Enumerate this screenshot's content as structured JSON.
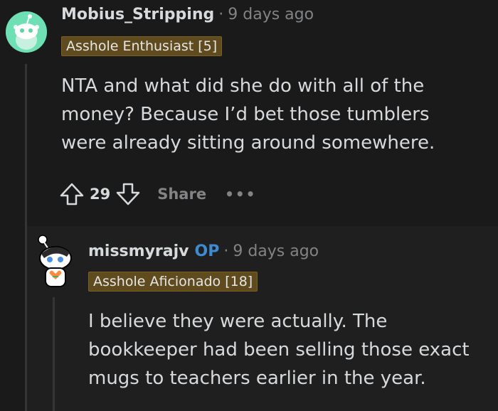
{
  "comment1": {
    "username": "Mobius_Stripping",
    "separator": "·",
    "time": "9 days ago",
    "flair": "Asshole Enthusiast [5]",
    "body": "NTA and what did she do with all of the\nmoney? Because I’d bet those tumblers\nwere already sitting around somewhere.",
    "score": "29",
    "share_label": "Share",
    "more_label": "•••",
    "avatar_icon": "snoo-avatar-icon"
  },
  "comment2": {
    "username": "missmyrajv",
    "op_badge": "OP",
    "separator": "·",
    "time": "9 days ago",
    "flair": "Asshole Aficionado [18]",
    "body": "I believe they were actually. The\nbookkeeper had been selling those exact\nmugs to teachers earlier in the year.",
    "avatar_icon": "snoo-avatar-icon"
  },
  "colors": {
    "background": "#1a1a1b",
    "flair_bg": "#5f4b1e",
    "op_blue": "#3d8bd1",
    "muted": "#818384"
  }
}
